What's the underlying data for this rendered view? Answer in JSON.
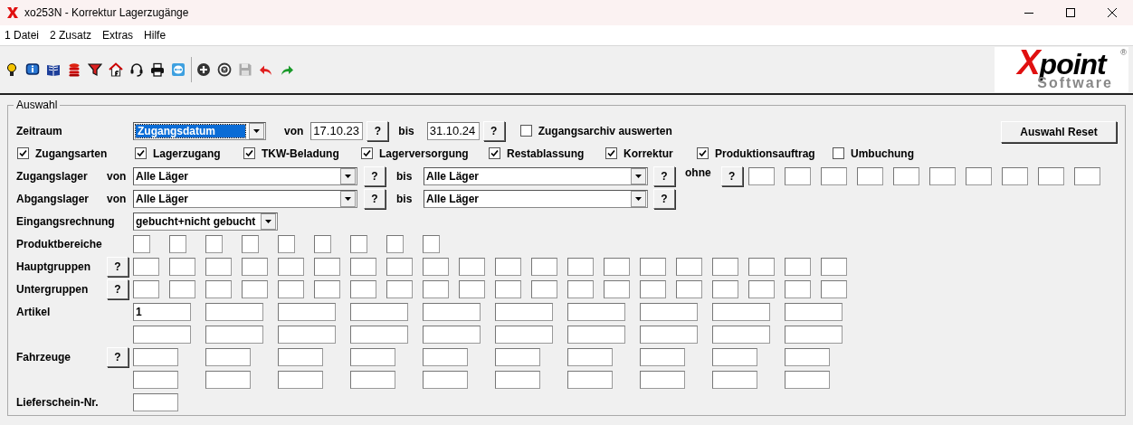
{
  "window": {
    "title": "xo253N - Korrektur Lagerzugänge"
  },
  "menu": [
    {
      "label": "1 Datei"
    },
    {
      "label": "2 Zusatz"
    },
    {
      "label": "Extras"
    },
    {
      "label": "Hilfe"
    }
  ],
  "logo": {
    "mark": "X",
    "word": "point",
    "sub": "Software",
    "reg": "®"
  },
  "selection": {
    "title": "Auswahl",
    "period": {
      "label": "Zeitraum",
      "value": "Zugangsdatum",
      "focused": true,
      "from_label": "von",
      "from": "17.10.23",
      "from_help": "?",
      "to_label": "bis",
      "to": "31.10.24",
      "to_help": "?",
      "archive": {
        "label": "Zugangsarchiv auswerten",
        "checked": false
      }
    },
    "reset_button": "Auswahl Reset",
    "types": [
      {
        "label": "Zugangsarten",
        "checked": true
      },
      {
        "label": "Lagerzugang",
        "checked": true
      },
      {
        "label": "TKW-Beladung",
        "checked": true
      },
      {
        "label": "Lagerversorgung",
        "checked": true
      },
      {
        "label": "Restablassung",
        "checked": true
      },
      {
        "label": "Korrektur",
        "checked": true
      },
      {
        "label": "Produktionsauftrag",
        "checked": true
      },
      {
        "label": "Umbuchung",
        "checked": false
      }
    ],
    "stores": [
      {
        "label": "Zugangslager",
        "from_label": "von",
        "from": "Alle Läger",
        "from_help": "?",
        "to_label": "bis",
        "to": "Alle Läger",
        "to_help": "?",
        "without_label": "ohne",
        "without_help": "?"
      },
      {
        "label": "Abgangslager",
        "from_label": "von",
        "from": "Alle Läger",
        "from_help": "?",
        "to_label": "bis",
        "to": "Alle Läger",
        "to_help": "?"
      }
    ],
    "invoice": {
      "label": "Eingangsrechnung",
      "value": "gebucht+nicht gebucht"
    },
    "product_areas": {
      "label": "Produktbereiche"
    },
    "main_groups": {
      "label": "Hauptgruppen",
      "help": "?"
    },
    "sub_groups": {
      "label": "Untergruppen",
      "help": "?"
    },
    "articles": {
      "label": "Artikel",
      "values": [
        "1"
      ]
    },
    "vehicles": {
      "label": "Fahrzeuge",
      "help": "?"
    },
    "delivery_note": {
      "label": "Lieferschein-Nr."
    }
  }
}
